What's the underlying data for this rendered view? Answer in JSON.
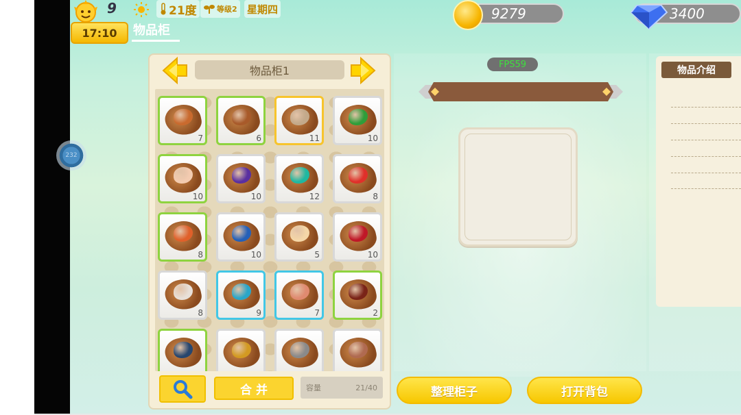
{
  "status": {
    "sun_value": "9",
    "time": "17:10",
    "temperature": "21度",
    "level": "等级2",
    "weekday": "星期四"
  },
  "page_tab": "物品柜",
  "currency": {
    "coins": "9279",
    "gems": "3400"
  },
  "float_ball_text": "232",
  "inventory": {
    "title": "物品柜1",
    "slots": [
      {
        "count": "7",
        "border": "green",
        "gem": "#c96a2e"
      },
      {
        "count": "6",
        "border": "green",
        "gem": "#a85a2a"
      },
      {
        "count": "11",
        "border": "yellow",
        "gem": "#c3a98a"
      },
      {
        "count": "10",
        "border": "gray",
        "gem": "#2f9e3a"
      },
      {
        "count": "10",
        "border": "green",
        "gem": "#f3cbb0"
      },
      {
        "count": "10",
        "border": "gray",
        "gem": "#5a2fa0"
      },
      {
        "count": "12",
        "border": "gray",
        "gem": "#1fb8a0"
      },
      {
        "count": "8",
        "border": "gray",
        "gem": "#e0302a"
      },
      {
        "count": "8",
        "border": "green",
        "gem": "#e0602a"
      },
      {
        "count": "10",
        "border": "gray",
        "gem": "#2460b8"
      },
      {
        "count": "5",
        "border": "gray",
        "gem": "#f5d7a8"
      },
      {
        "count": "10",
        "border": "gray",
        "gem": "#c01828"
      },
      {
        "count": "8",
        "border": "gray",
        "gem": "#e8e0d8"
      },
      {
        "count": "9",
        "border": "blue",
        "gem": "#2aa6c8"
      },
      {
        "count": "7",
        "border": "blue",
        "gem": "#e08a70"
      },
      {
        "count": "2",
        "border": "green",
        "gem": "#7a2418"
      },
      {
        "count": "",
        "border": "green",
        "gem": "#27466e"
      },
      {
        "count": "",
        "border": "gray",
        "gem": "#d39a22"
      },
      {
        "count": "",
        "border": "gray",
        "gem": "#8a8a8a"
      },
      {
        "count": "",
        "border": "gray",
        "gem": "#b06a50"
      }
    ],
    "merge_label": "合 并",
    "capacity_label": "容量",
    "capacity_value": "21/40"
  },
  "middle": {
    "fps": "FPS59"
  },
  "buttons": {
    "sort": "整理柜子",
    "open_bag": "打开背包"
  },
  "description": {
    "title": "物品介绍"
  },
  "colors": {
    "accent_yellow": "#fbd42f",
    "panel_beige": "#f6eed7",
    "brown": "#7a5a3a"
  }
}
